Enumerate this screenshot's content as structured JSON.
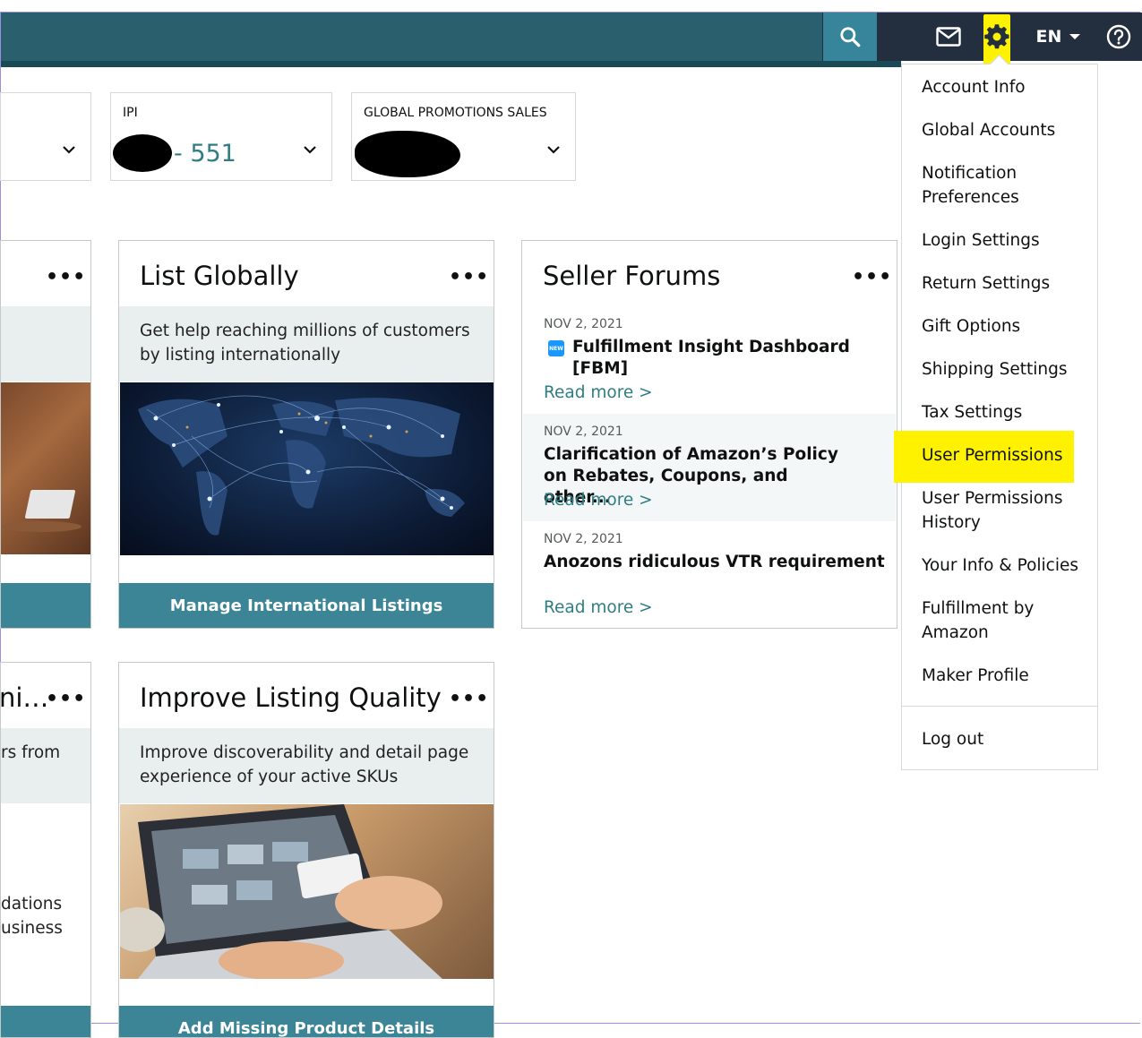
{
  "topbar": {
    "language": "EN",
    "icons": {
      "search": "search-icon",
      "mail": "mail-icon",
      "settings": "gear-icon",
      "help": "help-icon"
    }
  },
  "metrics": [
    {
      "label": "",
      "value": ""
    },
    {
      "label": "IPI",
      "value": "- 551"
    },
    {
      "label": "GLOBAL PROMOTIONS SALES",
      "value": ""
    }
  ],
  "cards": {
    "partial_top": {
      "cta": ""
    },
    "list_globally": {
      "title": "List Globally",
      "description": "Get help reaching millions of customers by listing internationally",
      "cta": "Manage International Listings"
    },
    "seller_forums": {
      "title": "Seller Forums",
      "posts": [
        {
          "date": "NOV 2, 2021",
          "title": "Fulfillment Insight Dashboard [FBM]",
          "badge": "NEW",
          "more": "Read more >"
        },
        {
          "date": "NOV 2, 2021",
          "title": "Clarification of Amazon’s Policy on Rebates, Coupons, and other...",
          "more": "Read more >"
        },
        {
          "date": "NOV 2, 2021",
          "title": "Anozons ridiculous VTR requirement",
          "more": "Read more >"
        }
      ]
    },
    "partial_bottom": {
      "title": "ni…",
      "desc_fragment": "rs from",
      "body_fragment_1": "dations",
      "body_fragment_2": "usiness"
    },
    "improve_listing": {
      "title": "Improve Listing Quality",
      "description": "Improve discoverability and detail page experience of your active SKUs",
      "cta": "Add Missing Product Details"
    }
  },
  "menu": {
    "items": [
      "Account Info",
      "Global Accounts",
      "Notification Preferences",
      "Login Settings",
      "Return Settings",
      "Gift Options",
      "Shipping Settings",
      "Tax Settings",
      "User Permissions",
      "User Permissions History",
      "Your Info & Policies",
      "Fulfillment by Amazon",
      "Maker Profile"
    ],
    "logout": "Log out",
    "highlighted": "User Permissions"
  },
  "colors": {
    "teal": "#3b8597",
    "link": "#2f7d83",
    "highlight": "#fff200",
    "nav": "#232f3e"
  }
}
